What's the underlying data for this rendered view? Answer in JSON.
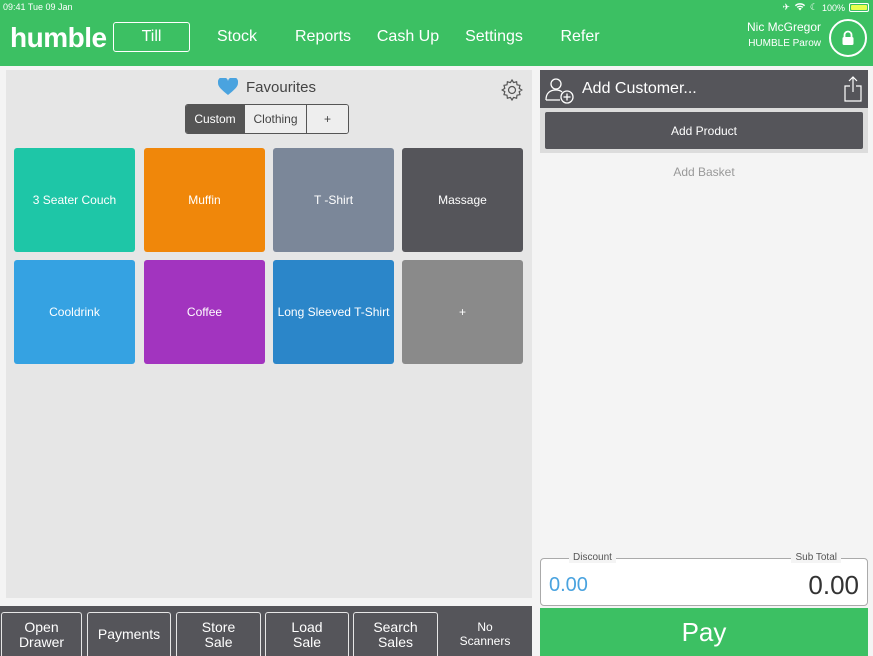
{
  "status": {
    "time_date": "09:41  Tue 09 Jan",
    "battery": "100%"
  },
  "header": {
    "logo": "humble",
    "nav": [
      "Till",
      "Stock",
      "Reports",
      "Cash Up",
      "Settings",
      "Refer"
    ],
    "user_name": "Nic McGregor",
    "store_name": "HUMBLE Parow",
    "accent": "#3cc063"
  },
  "favourites": {
    "title": "Favourites",
    "tabs": [
      "Custom",
      "Clothing",
      "+"
    ],
    "active_tab": "Custom",
    "tiles": [
      {
        "label": "3 Seater Couch",
        "color": "#1ec6a7"
      },
      {
        "label": "Muffin",
        "color": "#f0870a"
      },
      {
        "label": "T -Shirt",
        "color": "#7b8799"
      },
      {
        "label": "Massage",
        "color": "#55555a"
      },
      {
        "label": "Cooldrink",
        "color": "#35a2e2"
      },
      {
        "label": "Coffee",
        "color": "#a234bf"
      },
      {
        "label": "Long Sleeved T-Shirt",
        "color": "#2b86c9"
      },
      {
        "label": "+",
        "color": "#8a8a8a"
      }
    ]
  },
  "bottom_buttons": [
    {
      "line1": "Open",
      "line2": "Drawer"
    },
    {
      "line1": "Payments",
      "line2": ""
    },
    {
      "line1": "Store",
      "line2": "Sale"
    },
    {
      "line1": "Load",
      "line2": "Sale"
    },
    {
      "line1": "Search",
      "line2": "Sales"
    },
    {
      "line1": "No",
      "line2": "Scanners"
    }
  ],
  "basket": {
    "add_customer": "Add Customer...",
    "add_product": "Add Product",
    "add_basket": "Add Basket",
    "discount_label": "Discount",
    "discount_value": "0.00",
    "subtotal_label": "Sub Total",
    "subtotal_value": "0.00",
    "pay_label": "Pay"
  }
}
